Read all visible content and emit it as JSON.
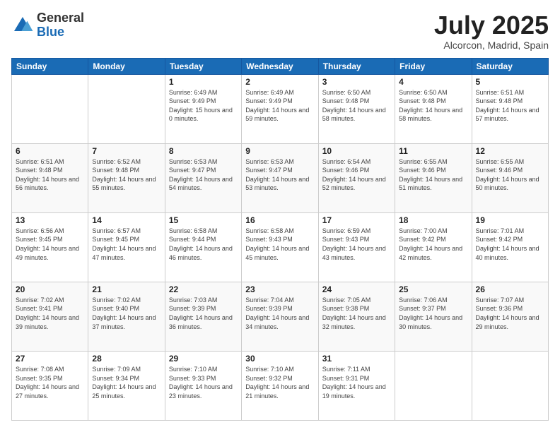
{
  "logo": {
    "general": "General",
    "blue": "Blue"
  },
  "header": {
    "month": "July 2025",
    "location": "Alcorcon, Madrid, Spain"
  },
  "weekdays": [
    "Sunday",
    "Monday",
    "Tuesday",
    "Wednesday",
    "Thursday",
    "Friday",
    "Saturday"
  ],
  "weeks": [
    [
      {
        "day": "",
        "info": ""
      },
      {
        "day": "",
        "info": ""
      },
      {
        "day": "1",
        "info": "Sunrise: 6:49 AM\nSunset: 9:49 PM\nDaylight: 15 hours and 0 minutes."
      },
      {
        "day": "2",
        "info": "Sunrise: 6:49 AM\nSunset: 9:49 PM\nDaylight: 14 hours and 59 minutes."
      },
      {
        "day": "3",
        "info": "Sunrise: 6:50 AM\nSunset: 9:48 PM\nDaylight: 14 hours and 58 minutes."
      },
      {
        "day": "4",
        "info": "Sunrise: 6:50 AM\nSunset: 9:48 PM\nDaylight: 14 hours and 58 minutes."
      },
      {
        "day": "5",
        "info": "Sunrise: 6:51 AM\nSunset: 9:48 PM\nDaylight: 14 hours and 57 minutes."
      }
    ],
    [
      {
        "day": "6",
        "info": "Sunrise: 6:51 AM\nSunset: 9:48 PM\nDaylight: 14 hours and 56 minutes."
      },
      {
        "day": "7",
        "info": "Sunrise: 6:52 AM\nSunset: 9:48 PM\nDaylight: 14 hours and 55 minutes."
      },
      {
        "day": "8",
        "info": "Sunrise: 6:53 AM\nSunset: 9:47 PM\nDaylight: 14 hours and 54 minutes."
      },
      {
        "day": "9",
        "info": "Sunrise: 6:53 AM\nSunset: 9:47 PM\nDaylight: 14 hours and 53 minutes."
      },
      {
        "day": "10",
        "info": "Sunrise: 6:54 AM\nSunset: 9:46 PM\nDaylight: 14 hours and 52 minutes."
      },
      {
        "day": "11",
        "info": "Sunrise: 6:55 AM\nSunset: 9:46 PM\nDaylight: 14 hours and 51 minutes."
      },
      {
        "day": "12",
        "info": "Sunrise: 6:55 AM\nSunset: 9:46 PM\nDaylight: 14 hours and 50 minutes."
      }
    ],
    [
      {
        "day": "13",
        "info": "Sunrise: 6:56 AM\nSunset: 9:45 PM\nDaylight: 14 hours and 49 minutes."
      },
      {
        "day": "14",
        "info": "Sunrise: 6:57 AM\nSunset: 9:45 PM\nDaylight: 14 hours and 47 minutes."
      },
      {
        "day": "15",
        "info": "Sunrise: 6:58 AM\nSunset: 9:44 PM\nDaylight: 14 hours and 46 minutes."
      },
      {
        "day": "16",
        "info": "Sunrise: 6:58 AM\nSunset: 9:43 PM\nDaylight: 14 hours and 45 minutes."
      },
      {
        "day": "17",
        "info": "Sunrise: 6:59 AM\nSunset: 9:43 PM\nDaylight: 14 hours and 43 minutes."
      },
      {
        "day": "18",
        "info": "Sunrise: 7:00 AM\nSunset: 9:42 PM\nDaylight: 14 hours and 42 minutes."
      },
      {
        "day": "19",
        "info": "Sunrise: 7:01 AM\nSunset: 9:42 PM\nDaylight: 14 hours and 40 minutes."
      }
    ],
    [
      {
        "day": "20",
        "info": "Sunrise: 7:02 AM\nSunset: 9:41 PM\nDaylight: 14 hours and 39 minutes."
      },
      {
        "day": "21",
        "info": "Sunrise: 7:02 AM\nSunset: 9:40 PM\nDaylight: 14 hours and 37 minutes."
      },
      {
        "day": "22",
        "info": "Sunrise: 7:03 AM\nSunset: 9:39 PM\nDaylight: 14 hours and 36 minutes."
      },
      {
        "day": "23",
        "info": "Sunrise: 7:04 AM\nSunset: 9:39 PM\nDaylight: 14 hours and 34 minutes."
      },
      {
        "day": "24",
        "info": "Sunrise: 7:05 AM\nSunset: 9:38 PM\nDaylight: 14 hours and 32 minutes."
      },
      {
        "day": "25",
        "info": "Sunrise: 7:06 AM\nSunset: 9:37 PM\nDaylight: 14 hours and 30 minutes."
      },
      {
        "day": "26",
        "info": "Sunrise: 7:07 AM\nSunset: 9:36 PM\nDaylight: 14 hours and 29 minutes."
      }
    ],
    [
      {
        "day": "27",
        "info": "Sunrise: 7:08 AM\nSunset: 9:35 PM\nDaylight: 14 hours and 27 minutes."
      },
      {
        "day": "28",
        "info": "Sunrise: 7:09 AM\nSunset: 9:34 PM\nDaylight: 14 hours and 25 minutes."
      },
      {
        "day": "29",
        "info": "Sunrise: 7:10 AM\nSunset: 9:33 PM\nDaylight: 14 hours and 23 minutes."
      },
      {
        "day": "30",
        "info": "Sunrise: 7:10 AM\nSunset: 9:32 PM\nDaylight: 14 hours and 21 minutes."
      },
      {
        "day": "31",
        "info": "Sunrise: 7:11 AM\nSunset: 9:31 PM\nDaylight: 14 hours and 19 minutes."
      },
      {
        "day": "",
        "info": ""
      },
      {
        "day": "",
        "info": ""
      }
    ]
  ]
}
